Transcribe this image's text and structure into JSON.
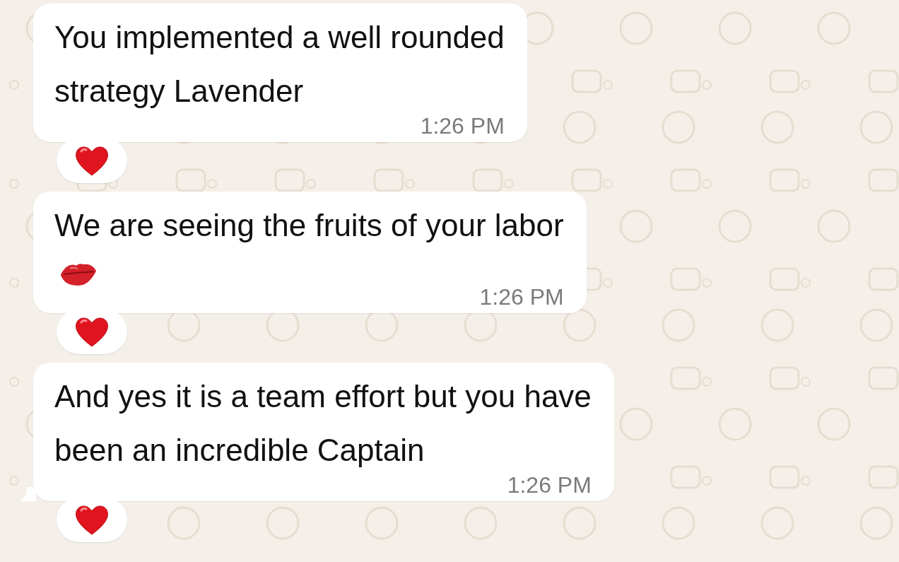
{
  "messages": [
    {
      "text": "You implemented a well rounded\nstrategy Lavender",
      "time": "1:26 PM",
      "tail": false,
      "reaction": {
        "kind": "heart"
      }
    },
    {
      "text": "We are seeing the fruits of your labor",
      "sticker": {
        "kind": "lips"
      },
      "time": "1:26 PM",
      "tail": false,
      "reaction": {
        "kind": "heart"
      }
    },
    {
      "text": "And yes it is a team effort but you have\nbeen an incredible Captain",
      "time": "1:26 PM",
      "tail": true,
      "reaction": {
        "kind": "heart"
      }
    }
  ]
}
